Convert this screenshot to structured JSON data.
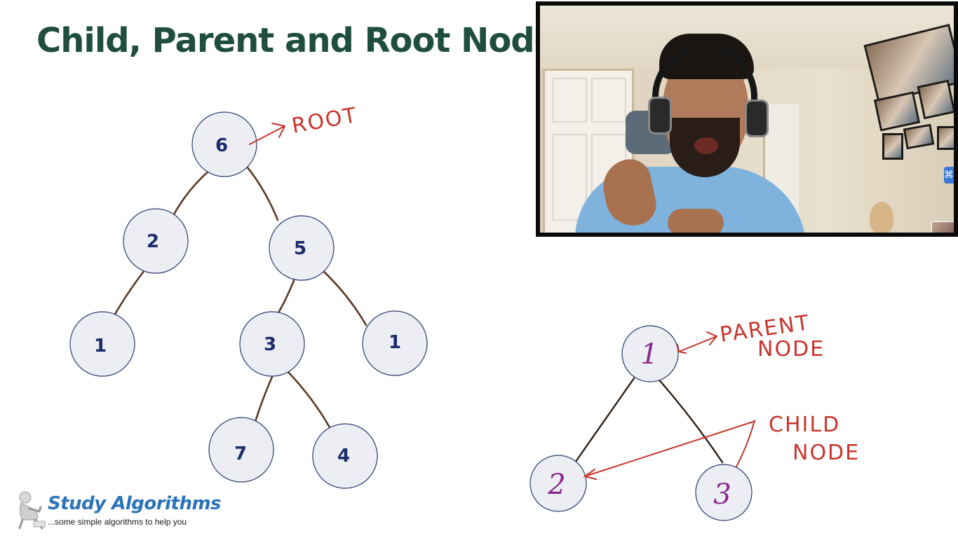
{
  "slide": {
    "title": "Child, Parent and Root Node"
  },
  "main_tree": {
    "nodes": [
      {
        "id": "n6",
        "value": "6"
      },
      {
        "id": "n2",
        "value": "2"
      },
      {
        "id": "n5",
        "value": "5"
      },
      {
        "id": "n1a",
        "value": "1"
      },
      {
        "id": "n3",
        "value": "3"
      },
      {
        "id": "n1b",
        "value": "1"
      },
      {
        "id": "n7",
        "value": "7"
      },
      {
        "id": "n4",
        "value": "4"
      }
    ],
    "edges": [
      [
        "n6",
        "n2"
      ],
      [
        "n6",
        "n5"
      ],
      [
        "n2",
        "n1a"
      ],
      [
        "n5",
        "n3"
      ],
      [
        "n5",
        "n1b"
      ],
      [
        "n3",
        "n7"
      ],
      [
        "n3",
        "n4"
      ]
    ],
    "annotation": {
      "label": "ROOT",
      "color": "#c8352c"
    }
  },
  "small_tree": {
    "nodes": [
      {
        "id": "s1",
        "value": "1"
      },
      {
        "id": "s2",
        "value": "2"
      },
      {
        "id": "s3",
        "value": "3"
      }
    ],
    "edges": [
      [
        "s1",
        "s2"
      ],
      [
        "s1",
        "s3"
      ]
    ],
    "parent_label": [
      "PARENT",
      "NODE"
    ],
    "child_label": [
      "CHILD",
      "NODE"
    ]
  },
  "webcam": {
    "description_icon": "presenter-video-feed",
    "side_icon": "command-icon",
    "side_glyph": "⌘"
  },
  "branding": {
    "name": "Study Algorithms",
    "tagline": "...some simple algorithms to help you",
    "accent": "#2b73b8",
    "icon": "thinking-figure-icon"
  },
  "colors": {
    "title": "#1f4e3d",
    "node_fill": "#eceef4",
    "node_text": "#1d2c6b",
    "annotation": "#c8352c",
    "handwritten_value": "#8a2a8c"
  }
}
